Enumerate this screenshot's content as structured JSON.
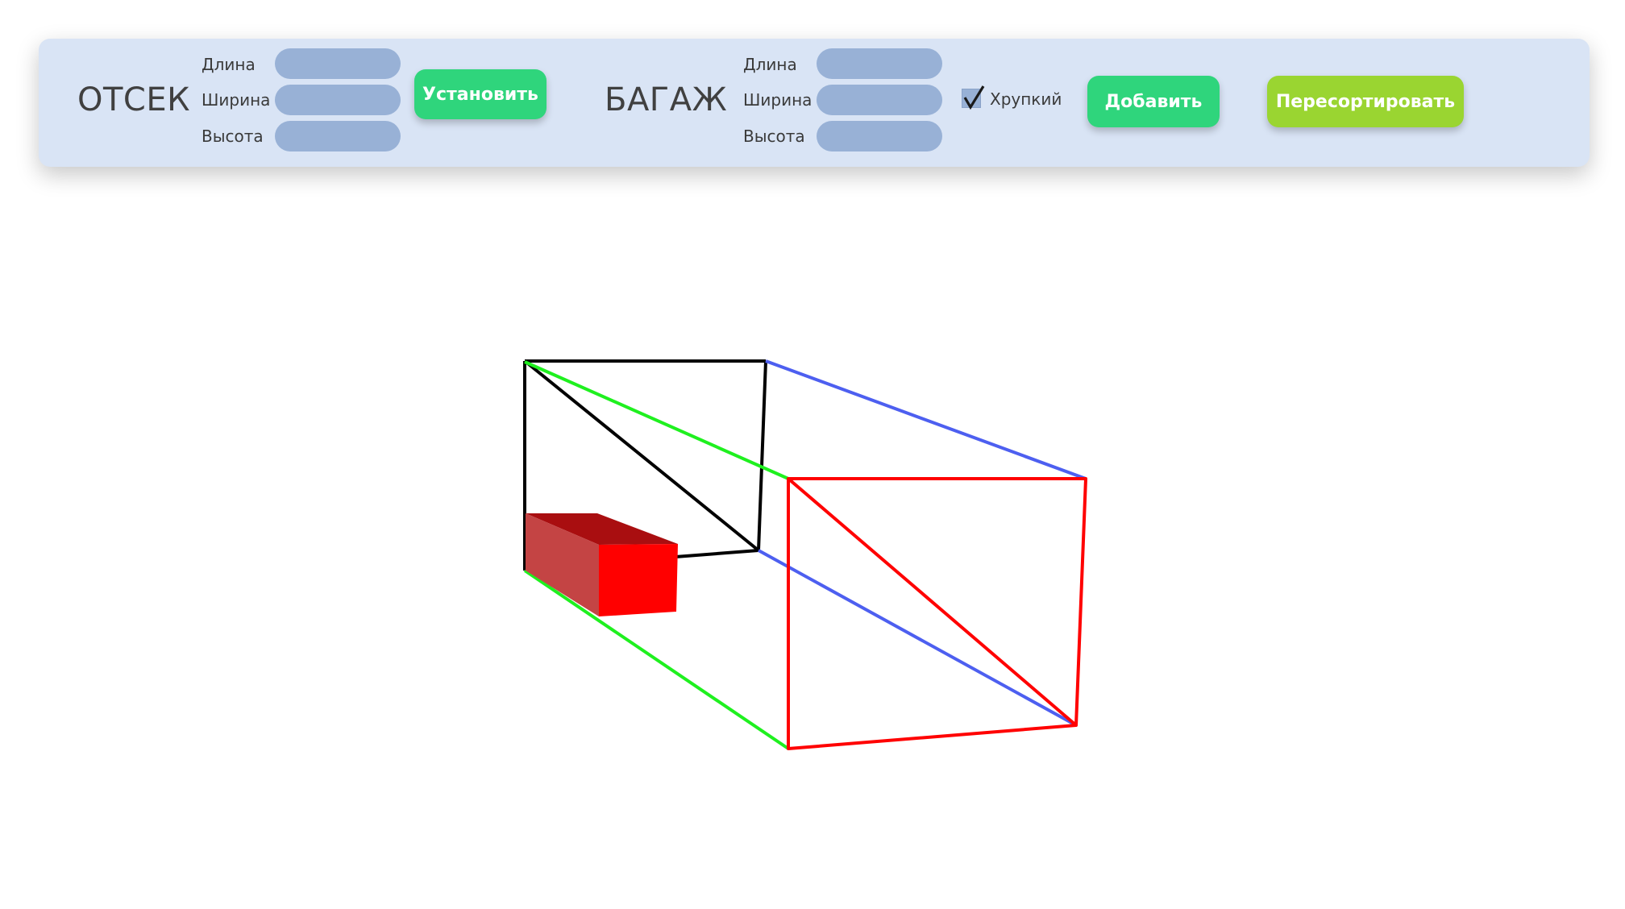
{
  "compartment": {
    "title": "ОТСЕК",
    "length_label": "Длина",
    "width_label": "Ширина",
    "height_label": "Высота",
    "length_value": "",
    "width_value": "",
    "height_value": "",
    "set_button_label": "Установить"
  },
  "luggage": {
    "title": "БАГАЖ",
    "length_label": "Длина",
    "width_label": "Ширина",
    "height_label": "Высота",
    "length_value": "",
    "width_value": "",
    "height_value": "",
    "fragile_label": "Хрупкий",
    "fragile_checked": true,
    "add_button_label": "Добавить"
  },
  "resort_button_label": "Пересортировать",
  "colors": {
    "toolbar_bg": "#d9e4f5",
    "input_bg": "#98b1d6",
    "set_button": "#2fd57c",
    "add_button": "#2fd57c",
    "resort_button": "#9ad531",
    "back_face": "#000000",
    "front_face": "#ff0000",
    "top_edges": "#4d5ff0",
    "bottom_edges": "#1ff01f",
    "luggage_box": "#ff0000"
  },
  "icons": {
    "fragile_checkbox": "checkmark-icon"
  }
}
